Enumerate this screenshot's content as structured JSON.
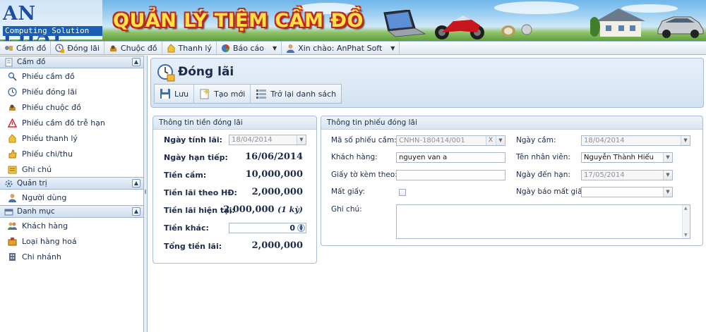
{
  "banner": {
    "logo_top": "AN PHAT",
    "logo_bottom": "Computing Solution",
    "app_title": "QUẢN LÝ TIỆM CẦM ĐỒ"
  },
  "menu": [
    {
      "label": "Cầm đồ",
      "icon": "pawn-icon"
    },
    {
      "label": "Đóng lãi",
      "icon": "clock-money-icon"
    },
    {
      "label": "Chuộc đồ",
      "icon": "redeem-icon"
    },
    {
      "label": "Thanh lý",
      "icon": "liquidate-icon"
    },
    {
      "label": "Báo cáo",
      "icon": "report-icon",
      "dropdown": true
    },
    {
      "label": "Xin chào: AnPhat Soft",
      "icon": "user-icon",
      "dropdown": true
    }
  ],
  "sidebar": {
    "sections": [
      {
        "title": "Cầm đồ",
        "items": [
          "Phiếu cầm đồ",
          "Phiếu đóng lãi",
          "Phiếu chuộc đồ",
          "Phiếu cầm đồ trễ hạn",
          "Phiếu thanh lý",
          "Phiếu chi/thu",
          "Ghi chú"
        ]
      },
      {
        "title": "Quản trị",
        "items": [
          "Người dùng"
        ]
      },
      {
        "title": "Danh mục",
        "items": [
          "Khách hàng",
          "Loại hàng hoá",
          "Chi nhánh"
        ]
      }
    ]
  },
  "page": {
    "title": "Đóng lãi",
    "toolbar": {
      "save": "Lưu",
      "new": "Tạo mới",
      "back": "Trở lại danh sách"
    }
  },
  "interest_panel": {
    "title": "Thông tin tiền đóng lãi",
    "ngay_tinh_lai_label": "Ngày tính lãi:",
    "ngay_tinh_lai_value": "18/04/2014",
    "ngay_han_tiep_label": "Ngày hạn tiếp:",
    "ngay_han_tiep_value": "16/06/2014",
    "tien_cam_label": "Tiền cầm:",
    "tien_cam_value": "10,000,000",
    "tien_lai_hd_label": "Tiền lãi theo HĐ:",
    "tien_lai_hd_value": "2,000,000",
    "tien_lai_ht_label": "Tiền lãi hiện tại:",
    "tien_lai_ht_value": "2,000,000",
    "tien_lai_ht_note": "(1 kỳ)",
    "tien_khac_label": "Tiền khác:",
    "tien_khac_value": "0",
    "tong_tien_lai_label": "Tổng tiền lãi:",
    "tong_tien_lai_value": "2,000,000"
  },
  "receipt_panel": {
    "title": "Thông tin phiếu đóng lãi",
    "ma_so_label": "Mã số phiếu cầm:",
    "ma_so_value": "CNHN-180414/001",
    "ngay_cam_label": "Ngày cầm:",
    "ngay_cam_value": "18/04/2014",
    "khach_hang_label": "Khách hàng:",
    "khach_hang_value": "nguyen van a",
    "nhan_vien_label": "Tên nhân viên:",
    "nhan_vien_value": "Nguyễn Thành Hiếu",
    "giay_to_label": "Giấy tờ kèm theo:",
    "giay_to_value": "",
    "ngay_den_han_label": "Ngày đến hạn:",
    "ngay_den_han_value": "17/05/2014",
    "mat_giay_label": "Mất giấy:",
    "ngay_bao_mat_label": "Ngày báo mất giấy:",
    "ngay_bao_mat_value": "",
    "ghi_chu_label": "Ghi chú:",
    "ghi_chu_value": ""
  }
}
